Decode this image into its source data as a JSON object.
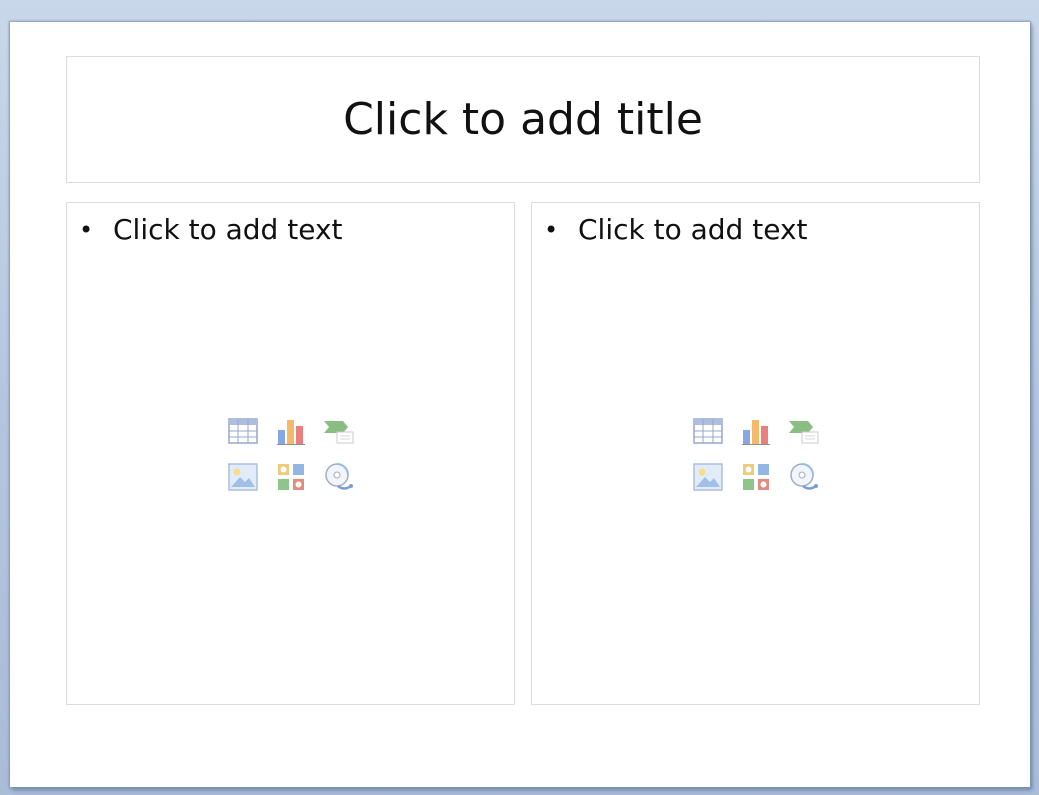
{
  "slide": {
    "title_placeholder": "Click to add title",
    "content_left": {
      "bullet": "•",
      "placeholder": "Click to add text",
      "insert_icons": [
        "insert-table-icon",
        "insert-chart-icon",
        "insert-smartart-icon",
        "insert-picture-icon",
        "insert-clip-art-icon",
        "insert-media-clip-icon"
      ]
    },
    "content_right": {
      "bullet": "•",
      "placeholder": "Click to add text",
      "insert_icons": [
        "insert-table-icon",
        "insert-chart-icon",
        "insert-smartart-icon",
        "insert-picture-icon",
        "insert-clip-art-icon",
        "insert-media-clip-icon"
      ]
    }
  },
  "colors": {
    "background": "#b4c6df",
    "slide": "#ffffff",
    "placeholder_border": "#dcdcdc",
    "text": "#111111"
  }
}
